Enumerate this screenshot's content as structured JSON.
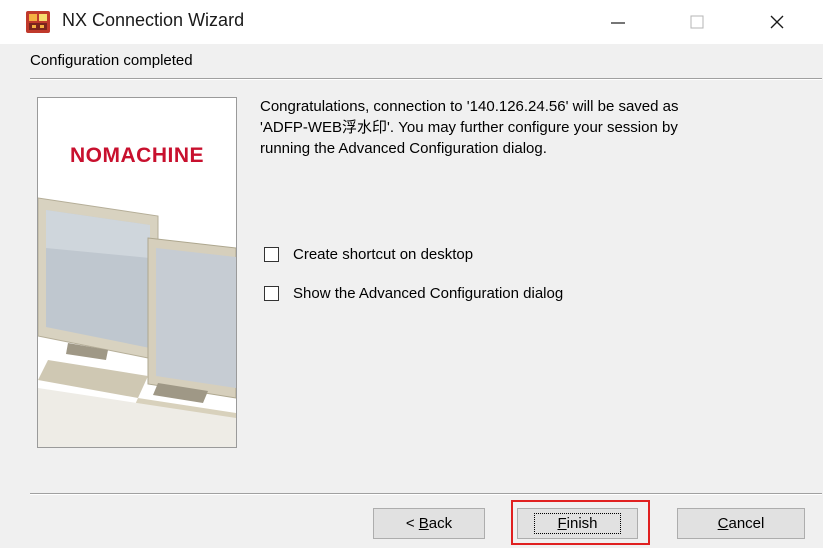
{
  "window": {
    "title": "NX Connection Wizard",
    "icon": "nx-app-icon",
    "controls": {
      "minimize": "—",
      "maximize": "☐",
      "close": "✕"
    }
  },
  "page": {
    "header": "Configuration completed",
    "logo": "NOMACHINE",
    "message_lines": [
      "Congratulations, connection to '140.126.24.56' will be saved as",
      "'ADFP-WEB浮水印'. You may further configure your session by",
      "running the Advanced Configuration dialog."
    ],
    "options": [
      {
        "label": "Create shortcut on desktop",
        "checked": false
      },
      {
        "label": "Show the Advanced Configuration dialog",
        "checked": false
      }
    ]
  },
  "buttons": {
    "back": {
      "prefix": "< ",
      "accel": "B",
      "rest": "ack"
    },
    "finish": {
      "accel": "F",
      "rest": "inish"
    },
    "cancel": {
      "accel": "C",
      "rest": "ancel"
    }
  },
  "colors": {
    "highlight": "#e02020",
    "logo": "#c8102e"
  }
}
